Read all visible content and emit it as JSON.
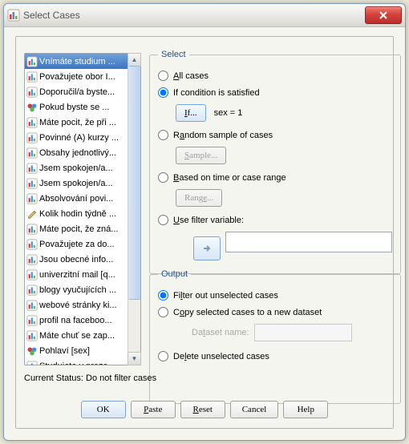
{
  "title": "Select Cases",
  "list": {
    "items": [
      "Vnímáte studium ...",
      "Považujete obor I...",
      "Doporučil/a byste...",
      "Pokud byste se ...",
      "Máte pocit, že při ...",
      "Povinné (A) kurzy ...",
      "Obsahy jednotlivý...",
      "Jsem spokojen/a...",
      "Jsem spokojen/a...",
      "Absolvování povi...",
      "Kolik hodin týdně ...",
      "Máte pocit, že zná...",
      "Považujete za do...",
      "Jsou obecné info...",
      "univerzitní mail [q...",
      "blogy vyučujících ...",
      "webové stránky ki...",
      "profil na faceboo...",
      "Máte chuť se zap...",
      "Pohlaví [sex]",
      "Studujete v preze..."
    ],
    "selected": 0,
    "pencilIndex": 10,
    "ballsIndex": [
      3,
      19
    ]
  },
  "select": {
    "legend": "Select",
    "all": "All cases",
    "if": "If condition is satisfied",
    "if_btn": "If...",
    "cond": "sex = 1",
    "random": "Random sample of cases",
    "sample_btn": "Sample...",
    "range": "Based on time or case range",
    "range_btn": "Range...",
    "usefilter": "Use filter variable:"
  },
  "output": {
    "legend": "Output",
    "filter": "Filter out unselected cases",
    "copy": "Copy selected cases to a new dataset",
    "dsname": "Dataset name:",
    "delete": "Delete unselected cases"
  },
  "status": "Current Status: Do not filter cases",
  "buttons": {
    "ok": "OK",
    "paste": "Paste",
    "reset": "Reset",
    "cancel": "Cancel",
    "help": "Help"
  }
}
